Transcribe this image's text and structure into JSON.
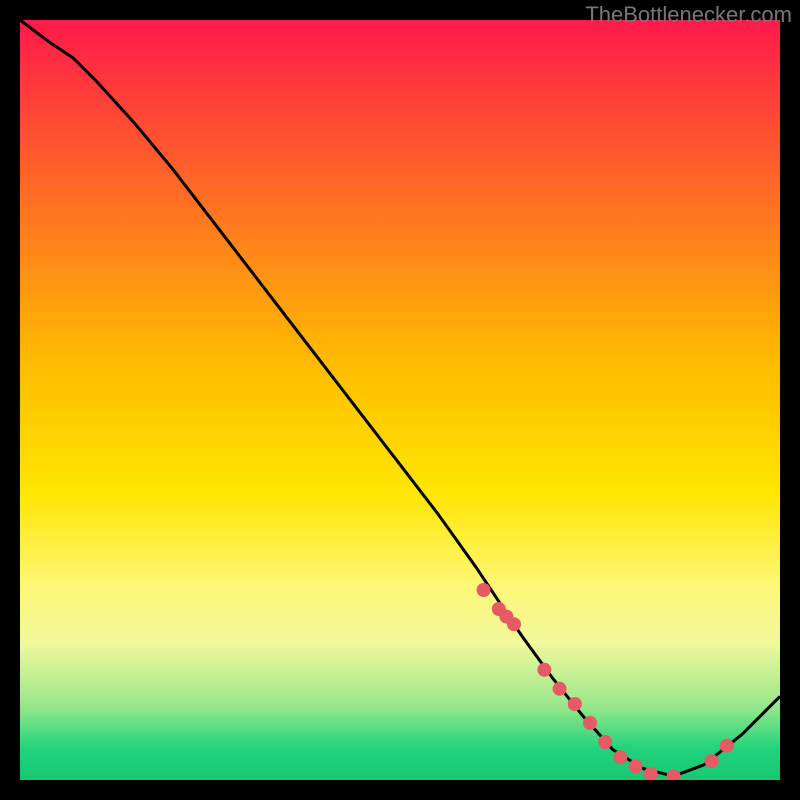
{
  "watermark": "TheBottlenecker.com",
  "chart_data": {
    "type": "line",
    "title": "",
    "xlabel": "",
    "ylabel": "",
    "xlim": [
      0,
      100
    ],
    "ylim": [
      0,
      100
    ],
    "series": [
      {
        "name": "curve",
        "x": [
          0,
          2,
          4,
          7,
          10,
          15,
          20,
          25,
          30,
          35,
          40,
          45,
          50,
          55,
          60,
          63,
          66,
          70,
          74,
          78,
          82,
          86,
          90,
          95,
          100
        ],
        "y": [
          100,
          98.5,
          97,
          95,
          92,
          86.5,
          80.5,
          74,
          67.5,
          61,
          54.5,
          48,
          41.5,
          35,
          28,
          23.5,
          19,
          13.5,
          8.5,
          4,
          1.5,
          0.5,
          2,
          6,
          11
        ]
      }
    ],
    "markers": {
      "name": "highlight-points",
      "x": [
        61,
        63,
        64,
        65,
        69,
        71,
        73,
        75,
        77,
        79,
        81,
        83,
        86,
        91,
        93
      ],
      "y": [
        25,
        22.5,
        21.5,
        20.5,
        14.5,
        12,
        10,
        7.5,
        5,
        3,
        1.8,
        0.8,
        0.5,
        2.5,
        4.5
      ]
    },
    "gradient_stops": [
      {
        "offset": 0,
        "color": "#ff1a4a"
      },
      {
        "offset": 45,
        "color": "#ffbb00"
      },
      {
        "offset": 62,
        "color": "#ffe600"
      },
      {
        "offset": 75,
        "color": "#fdf87a"
      },
      {
        "offset": 82,
        "color": "#f0f99c"
      },
      {
        "offset": 90,
        "color": "#9be88a"
      },
      {
        "offset": 96,
        "color": "#20d37b"
      },
      {
        "offset": 100,
        "color": "#18c774"
      }
    ]
  }
}
